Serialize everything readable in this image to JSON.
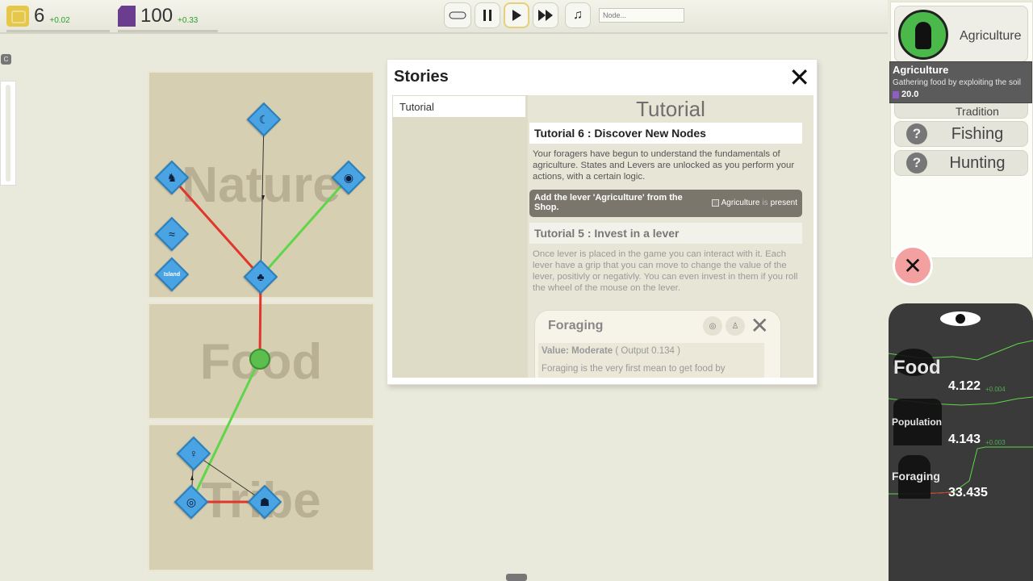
{
  "resources": {
    "money": {
      "value": "6",
      "delta": "+0.02",
      "icon": "coin-icon"
    },
    "knowledge": {
      "value": "100",
      "delta": "+0.33",
      "icon": "knowledge-icon"
    }
  },
  "controls": {
    "search_placeholder": "Node..."
  },
  "left": {
    "c_tag": "C"
  },
  "zones": {
    "nature": "Nature",
    "food": "Food",
    "tribe": "Tribe"
  },
  "nodes": {
    "island_label": "Island"
  },
  "stories": {
    "title": "Stories",
    "list": [
      "Tutorial"
    ],
    "section_title": "Tutorial",
    "tut6_title": "Tutorial 6 : Discover New Nodes",
    "tut6_text": "Your foragers have begun to understand the fundamentals of agriculture. States and Levers are unlocked as you perform your actions, with a certain logic.",
    "task_text": "Add the lever 'Agriculture' from the Shop.",
    "task_goal_name": "Agriculture",
    "task_goal_is": "is",
    "task_goal_state": "present",
    "tut5_title": "Tutorial 5 : Invest in a lever",
    "tut5_text": "Once lever is placed in the game you can interact with it. Each lever have a grip that you can move to change the value of the lever, positivly or negativly. You can even invest in them if you roll the wheel of the mouse on the lever.",
    "foraging": {
      "title": "Foraging",
      "value_label": "Value: Moderate",
      "output": "( Output 0.134 )",
      "text": "Foraging is the very first mean to get food by"
    }
  },
  "right_panel": {
    "agriculture_label": "Agriculture",
    "levers": [
      {
        "label": "Tradition"
      },
      {
        "label": "Fishing"
      },
      {
        "label": "Hunting"
      }
    ],
    "unknown_icon": "?"
  },
  "tooltip": {
    "title": "Agriculture",
    "desc": "Gathering food by exploiting the soil",
    "cost": "20.0"
  },
  "stats": {
    "food": {
      "name": "Food",
      "value": "4.122",
      "delta": "+0.004"
    },
    "population": {
      "name": "Population",
      "value": "4.143",
      "delta": "+0.003"
    },
    "foraging": {
      "name": "Foraging",
      "value": "33.435"
    }
  },
  "colors": {
    "positive_link": "#5fd64a",
    "negative_link": "#e0362b",
    "node": "#4aa3e2",
    "zone": "#d7cfb1"
  }
}
